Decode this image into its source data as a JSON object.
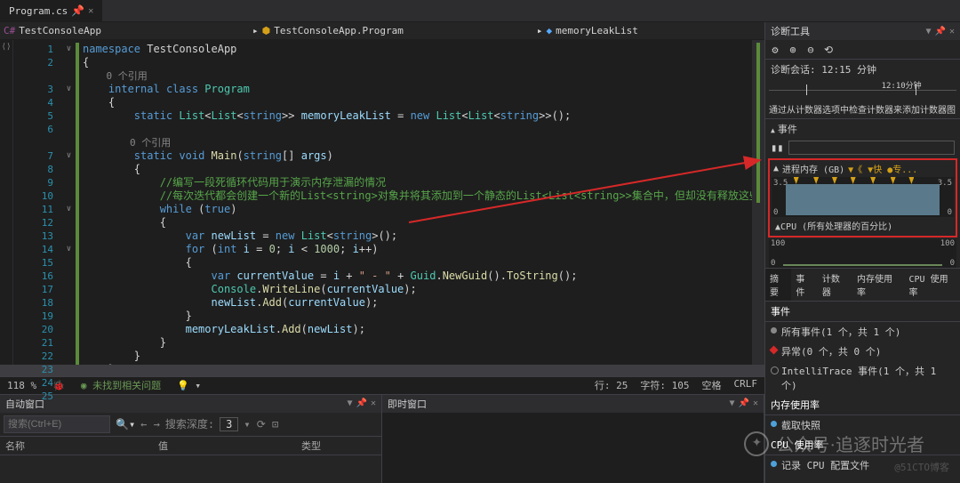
{
  "tab": {
    "name": "Program.cs"
  },
  "breadcrumbs": {
    "b1": "TestConsoleApp",
    "b2": "TestConsoleApp.Program",
    "b3": "memoryLeakList"
  },
  "code": {
    "l1": {
      "kw1": "namespace",
      "nm": " TestConsoleApp"
    },
    "l2": "{",
    "ref1": "0 个引用",
    "l3": {
      "kw1": "internal",
      "kw2": "class",
      "cls": "Program"
    },
    "l4": "{",
    "l5": {
      "kw1": "static",
      "t1": "List",
      "t2": "List",
      "t3": "string",
      "fld": "memoryLeakList",
      "eq": " = ",
      "kw2": "new",
      "t4": "List",
      "t5": "List",
      "t6": "string",
      "end": "();"
    },
    "blank6": "",
    "ref2": "0 个引用",
    "l7": {
      "kw1": "static",
      "kw2": "void",
      "m": "Main",
      "t": "string",
      "arr": "[]",
      "arg": "args"
    },
    "l8": "{",
    "l9": "//编写一段死循环代码用于演示内存泄漏的情况",
    "l10": "//每次迭代都会创建一个新的List<string>对象并将其添加到一个静态的List<List<string>>集合中，但却没有释放这些对象，从而导致内存泄漏",
    "l11": {
      "kw": "while",
      "cond": "true"
    },
    "l12": "{",
    "l13": {
      "kw": "var",
      "v": "newList",
      "eq": " = ",
      "kw2": "new",
      "t": "List",
      "t2": "string",
      "end": "();"
    },
    "l14": {
      "kw": "for",
      "p": "(",
      "kw2": "int",
      "v": "i",
      "eq": " = ",
      "n0": "0",
      "sc": "; ",
      "v2": "i",
      "lt": " < ",
      "n1": "1000",
      "sc2": "; ",
      "v3": "i",
      "pp": "++)"
    },
    "l15": "{",
    "l16": {
      "kw": "var",
      "v": "currentValue",
      "eq": " = ",
      "v2": "i",
      "op": " + ",
      "s": "\" - \"",
      "op2": " + ",
      "c": "Guid",
      "d": ".",
      "m": "NewGuid",
      "p": "().",
      "m2": "ToString",
      "p2": "();"
    },
    "l17": {
      "c": "Console",
      "d": ".",
      "m": "WriteLine",
      "p": "(",
      "v": "currentValue",
      "p2": ");"
    },
    "l18": {
      "v": "newList",
      "d": ".",
      "m": "Add",
      "p": "(",
      "v2": "currentValue",
      "p2": ");"
    },
    "l19": "}",
    "l20": {
      "v": "memoryLeakList",
      "d": ".",
      "m": "Add",
      "p": "(",
      "v2": "newList",
      "p2": ");"
    },
    "l21": "}",
    "l22": "}",
    "l23": "}",
    "blank24": ""
  },
  "status": {
    "zoom": "118 %",
    "issues": "未找到相关问题",
    "ln": "行: 25",
    "ch": "字符: 105",
    "spaces": "空格",
    "crlf": "CRLF"
  },
  "panels": {
    "auto": {
      "title": "自动窗口",
      "search_ph": "搜索(Ctrl+E)",
      "depth": "搜索深度:",
      "depth_v": "3",
      "col1": "名称",
      "col2": "值",
      "col3": "类型"
    },
    "imm": {
      "title": "即时窗口"
    }
  },
  "diag": {
    "title": "诊断工具",
    "session": "诊断会话: 12:15 分钟",
    "timeline_label": "12:10分钟",
    "msg": "通过从计数器选项中检查计数器来添加计数器图",
    "events_hdr": "事件",
    "mem_hdr": "进程内存 (GB)",
    "mem_legend": "▼《 ▼快 ●专...",
    "cpu_hdr": "CPU (所有处理器的百分比)",
    "tabs": {
      "t1": "摘要",
      "t2": "事件",
      "t3": "计数器",
      "t4": "内存使用率",
      "t5": "CPU 使用率"
    },
    "ev_section": "事件",
    "ev1": "所有事件(1 个，共 1 个)",
    "ev2": "异常(0 个，共 0 个)",
    "ev3": "IntelliTrace 事件(1 个，共 1 个)",
    "mem_section": "内存使用率",
    "mem_item": "截取快照",
    "cpu_section": "CPU 使用率",
    "cpu_item": "记录 CPU 配置文件"
  },
  "chart_data": {
    "memory": {
      "type": "area",
      "ylabel": "GB",
      "ylim": [
        0,
        3.5
      ],
      "y_ticks": [
        "3.5",
        "0"
      ],
      "values_approx": "flat near 3.4 GB",
      "gc_markers_count": 7
    },
    "cpu": {
      "type": "line",
      "ylabel": "%",
      "ylim": [
        0,
        100
      ],
      "y_ticks": [
        "100",
        "0"
      ],
      "values_approx": "near 0-5%"
    }
  },
  "watermark": {
    "main": "公众号·追逐时光者",
    "sub": "@51CTO博客"
  }
}
